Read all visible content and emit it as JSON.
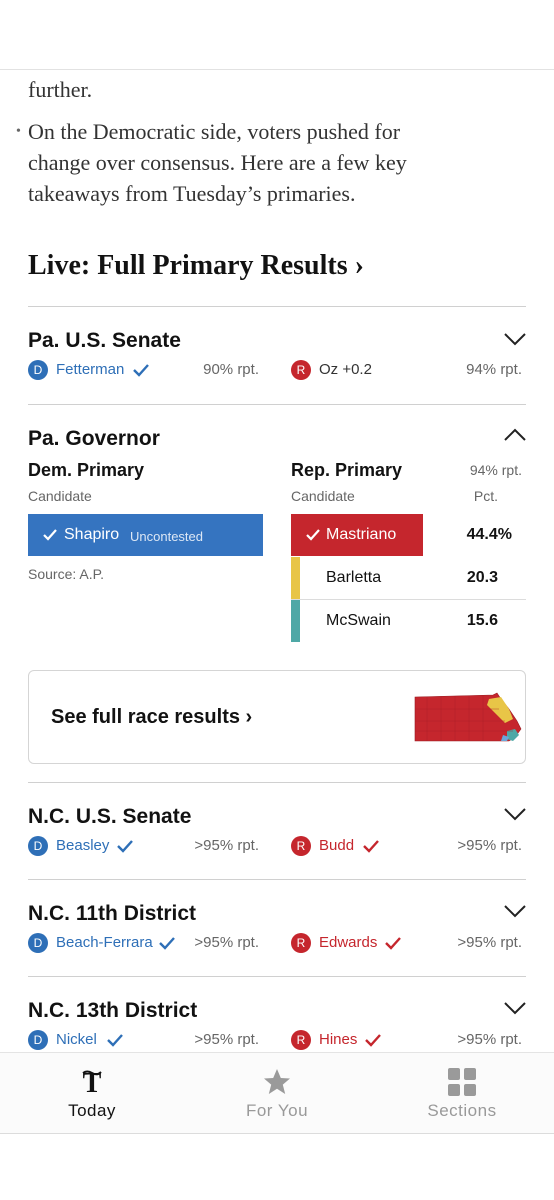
{
  "article": {
    "fragment": "further.",
    "bullet": "•",
    "paragraph_lines": [
      "On the Democratic side, voters pushed for",
      "change over consensus. Here are a few key",
      "takeaways from Tuesday’s primaries."
    ]
  },
  "live_header": "Live: Full Primary Results ›",
  "races": [
    {
      "title": "Pa. U.S. Senate",
      "dem": {
        "badge": "D",
        "name": "Fetterman",
        "winner": true,
        "reporting": "90% rpt."
      },
      "rep": {
        "badge": "R",
        "name": "Oz +0.2",
        "winner": false,
        "reporting": "94% rpt."
      },
      "expanded": false
    },
    {
      "title": "N.C. U.S. Senate",
      "dem": {
        "badge": "D",
        "name": "Beasley",
        "winner": true,
        "reporting": ">95% rpt."
      },
      "rep": {
        "badge": "R",
        "name": "Budd",
        "winner": true,
        "reporting": ">95% rpt."
      },
      "expanded": false
    },
    {
      "title": "N.C. 11th District",
      "dem": {
        "badge": "D",
        "name": "Beach-Ferrara",
        "winner": true,
        "reporting": ">95% rpt."
      },
      "rep": {
        "badge": "R",
        "name": "Edwards",
        "winner": true,
        "reporting": ">95% rpt."
      },
      "expanded": false
    },
    {
      "title": "N.C. 13th District",
      "dem": {
        "badge": "D",
        "name": "Nickel",
        "winner": true,
        "reporting": ">95% rpt."
      },
      "rep": {
        "badge": "R",
        "name": "Hines",
        "winner": true,
        "reporting": ">95% rpt."
      },
      "expanded": false
    }
  ],
  "governor": {
    "title": "Pa. Governor",
    "expanded": true,
    "dem": {
      "heading": "Dem. Primary",
      "col_label": "Candidate",
      "winner": "Shapiro",
      "status": "Uncontested",
      "source": "Source: A.P."
    },
    "rep": {
      "heading": "Rep. Primary",
      "reporting": "94% rpt.",
      "col_label": "Candidate",
      "pct_label": "Pct.",
      "candidates": [
        {
          "name": "Mastriano",
          "pct": "44.4%",
          "winner": true,
          "color": "#c5262d"
        },
        {
          "name": "Barletta",
          "pct": "20.3",
          "winner": false,
          "color": "#e8c547"
        },
        {
          "name": "McSwain",
          "pct": "15.6",
          "winner": false,
          "color": "#4ea8a6"
        }
      ]
    },
    "full_results": "See full race results ›"
  },
  "tabs": [
    {
      "label": "Today",
      "icon": "nyt-logo-icon",
      "active": true
    },
    {
      "label": "For You",
      "icon": "star-icon",
      "active": false
    },
    {
      "label": "Sections",
      "icon": "sections-grid-icon",
      "active": false
    }
  ],
  "colors": {
    "dem_blue": "#2e6fb7",
    "rep_red": "#c5262d",
    "barletta_yellow": "#e8c547",
    "mcswain_teal": "#4ea8a6"
  }
}
